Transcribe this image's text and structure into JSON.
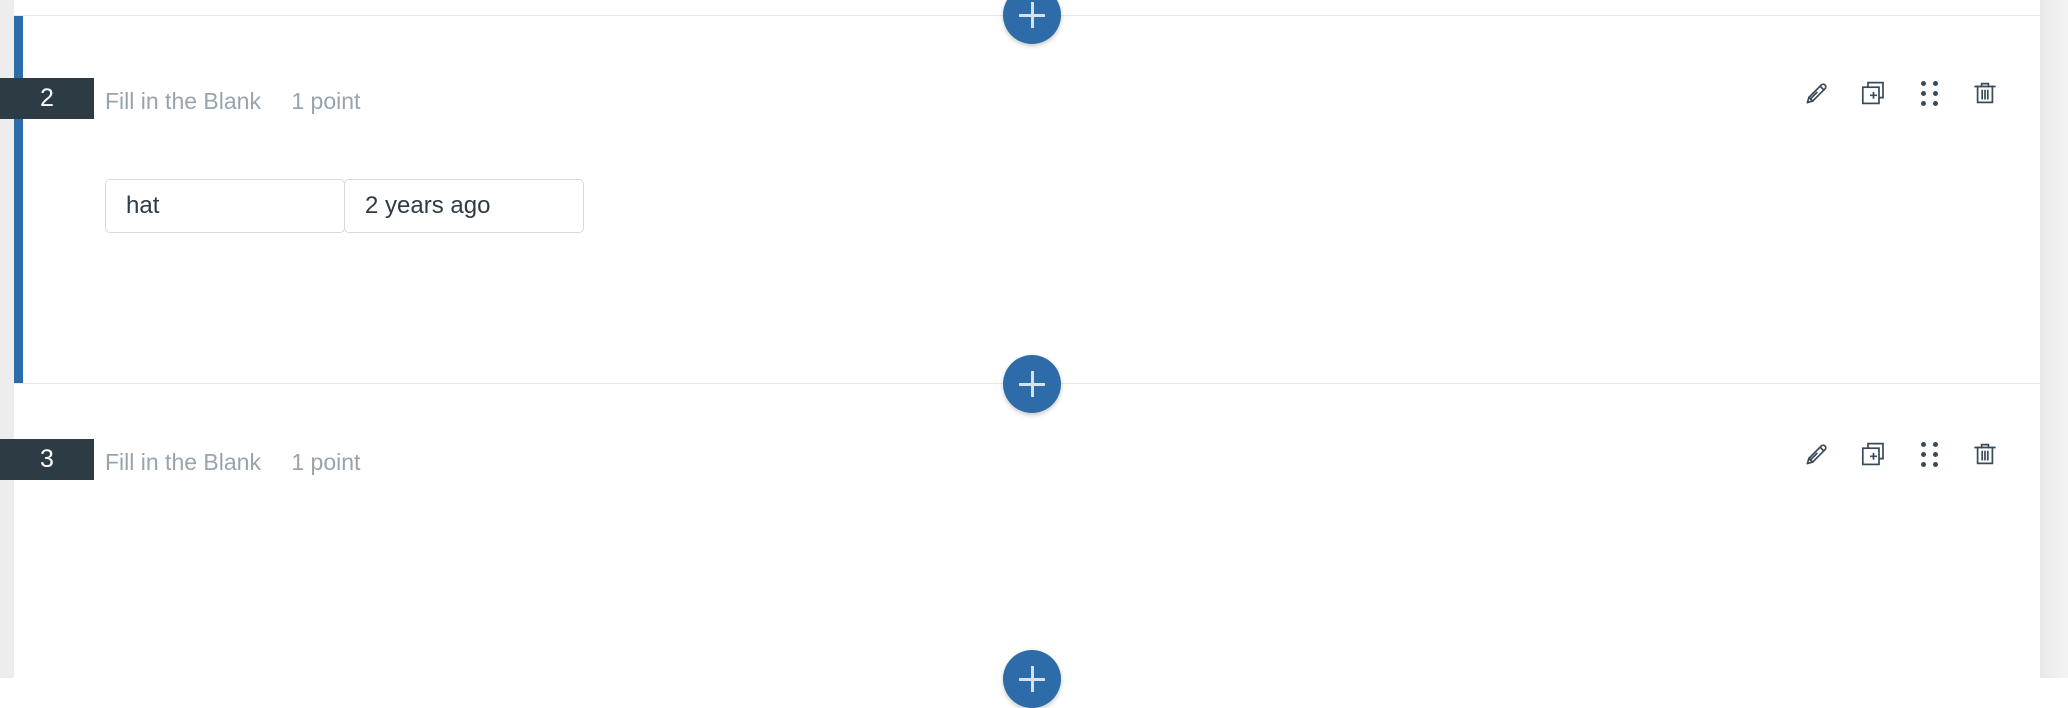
{
  "page": {
    "background_color": "#ffffff",
    "accent_color": "#2d6ca8",
    "badge_color": "#2d3b45",
    "meta_text_color": "#97a4ae"
  },
  "questions": [
    {
      "number": "2",
      "type": "Fill in the Blank",
      "points": "1 point",
      "selected": true,
      "answers": [
        {
          "value": "hat"
        },
        {
          "value": "2 years ago"
        }
      ],
      "actions": [
        {
          "name": "edit-icon",
          "label": "Edit"
        },
        {
          "name": "duplicate-icon",
          "label": "Duplicate"
        },
        {
          "name": "drag-handle-icon",
          "label": "Move"
        },
        {
          "name": "delete-icon",
          "label": "Delete"
        }
      ]
    },
    {
      "number": "3",
      "type": "Fill in the Blank",
      "points": "1 point",
      "selected": false,
      "answers": [],
      "actions": [
        {
          "name": "edit-icon",
          "label": "Edit"
        },
        {
          "name": "duplicate-icon",
          "label": "Duplicate"
        },
        {
          "name": "drag-handle-icon",
          "label": "Move"
        },
        {
          "name": "delete-icon",
          "label": "Delete"
        }
      ]
    }
  ],
  "add_buttons": [
    {
      "label": "+",
      "position": "top"
    },
    {
      "label": "+",
      "position": "middle"
    },
    {
      "label": "+",
      "position": "bottom"
    }
  ]
}
